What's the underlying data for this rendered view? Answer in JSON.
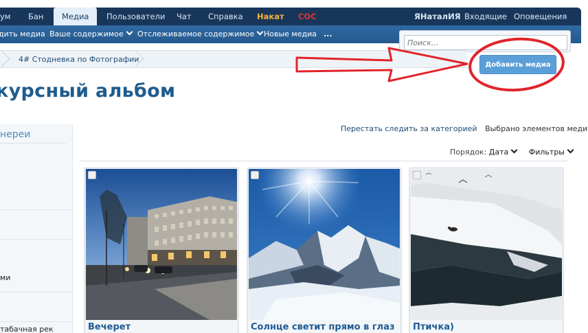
{
  "topnav": {
    "items": [
      "ум",
      "Бан",
      "Медиа",
      "Пользователи",
      "Чат",
      "Справка",
      "Накат",
      "СОС"
    ],
    "user": "ЯНаталИЯ",
    "inbox": "Входящие",
    "alerts": "Оповещения"
  },
  "subnav": {
    "items": [
      "дить медиа",
      "Ваше содержимое",
      "Отслеживаемое содержимое",
      "Новые медиа",
      "..."
    ]
  },
  "search": {
    "placeholder": "Поиск..."
  },
  "breadcrumb": {
    "current": "4# Стодневка по Фотографии"
  },
  "add_media_button": "Добавить медиа",
  "page_title": "курсный альбом",
  "sidebar": {
    "heading": "нереи",
    "items": [
      "ми",
      "табачная рек"
    ]
  },
  "actions": {
    "unfollow": "Перестать следить за категорией",
    "selected": "Выбрано элементов медиа: 0"
  },
  "sort": {
    "label": "Порядок:",
    "value": "Дата",
    "filters": "Фильтры"
  },
  "media": [
    {
      "title": "Вечерет"
    },
    {
      "title": "Солнце светит прямо в глаз"
    },
    {
      "title": "Птичка)"
    }
  ],
  "colors": {
    "nav_dark": "#18365a",
    "nav_blue": "#2f6aa3",
    "accent": "#1f5c8e",
    "button": "#5b9fd8",
    "annotation": "#e0242a"
  }
}
